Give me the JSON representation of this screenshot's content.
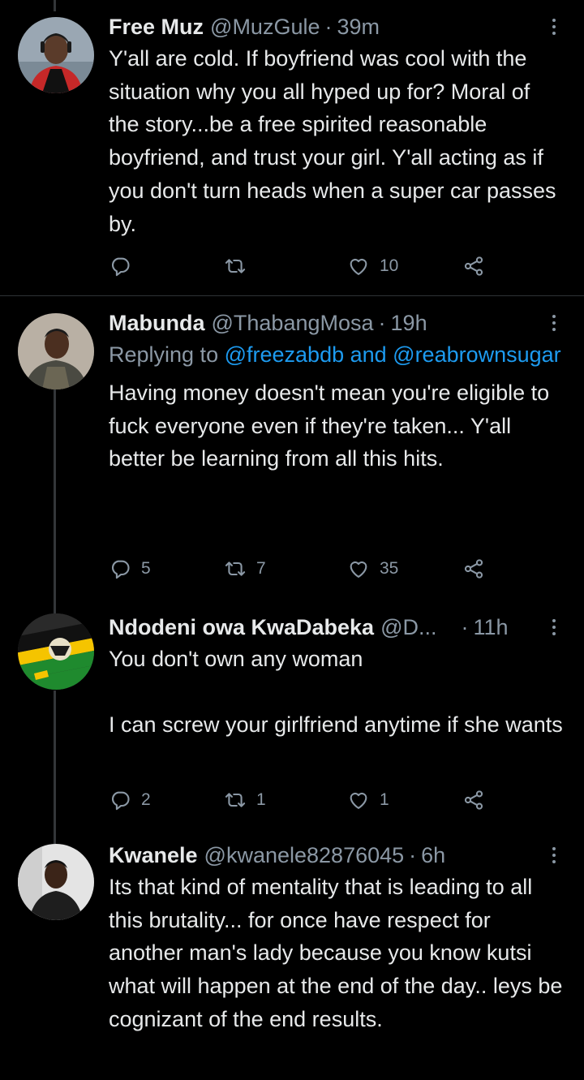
{
  "tweets": [
    {
      "name": "Free Muz",
      "handle": "@MuzGule",
      "sep": "·",
      "time": "39m",
      "replying_prefix": "",
      "replying_mentions": "",
      "text": "Y'all are cold. If boyfriend was cool with the situation why you all hyped up for? Moral of the story...be a free spirited reasonable boyfriend, and trust your girl. Y'all acting as if you don't turn heads when a super car passes by.",
      "reply_count": "",
      "retweet_count": "",
      "like_count": "10"
    },
    {
      "name": "Mabunda",
      "handle": "@ThabangMosa",
      "sep": "·",
      "time": "19h",
      "replying_prefix": "Replying to",
      "replying_mentions": "@freezabdb and @reabrownsugar",
      "text": "Having money doesn't mean you're eligible to fuck everyone even if they're taken... Y'all better be learning from all this hits.",
      "reply_count": "5",
      "retweet_count": "7",
      "like_count": "35"
    },
    {
      "name": "Ndodeni owa KwaDabeka",
      "handle": "@D...",
      "sep": "·",
      "time": "11h",
      "replying_prefix": "",
      "replying_mentions": "",
      "text": "You don't own any woman\n\nI can screw your girlfriend anytime if she wants",
      "reply_count": "2",
      "retweet_count": "1",
      "like_count": "1"
    },
    {
      "name": "Kwanele",
      "handle": "@kwanele82876045",
      "sep": "·",
      "time": "6h",
      "replying_prefix": "",
      "replying_mentions": "",
      "text": "Its that kind of mentality that is leading to all this brutality... for once have respect for another man's lady because you know kutsi what will happen at the end of the day.. leys be cognizant of the end results.",
      "reply_count": "",
      "retweet_count": "",
      "like_count": ""
    }
  ],
  "icons": {
    "reply": "reply-icon",
    "retweet": "retweet-icon",
    "like": "like-icon",
    "share": "share-icon",
    "more": "more-icon"
  },
  "colors": {
    "background": "#000000",
    "text": "#e7e9ea",
    "secondary": "#8b98a5",
    "link": "#1d9bf0",
    "divider": "#2f3336"
  }
}
